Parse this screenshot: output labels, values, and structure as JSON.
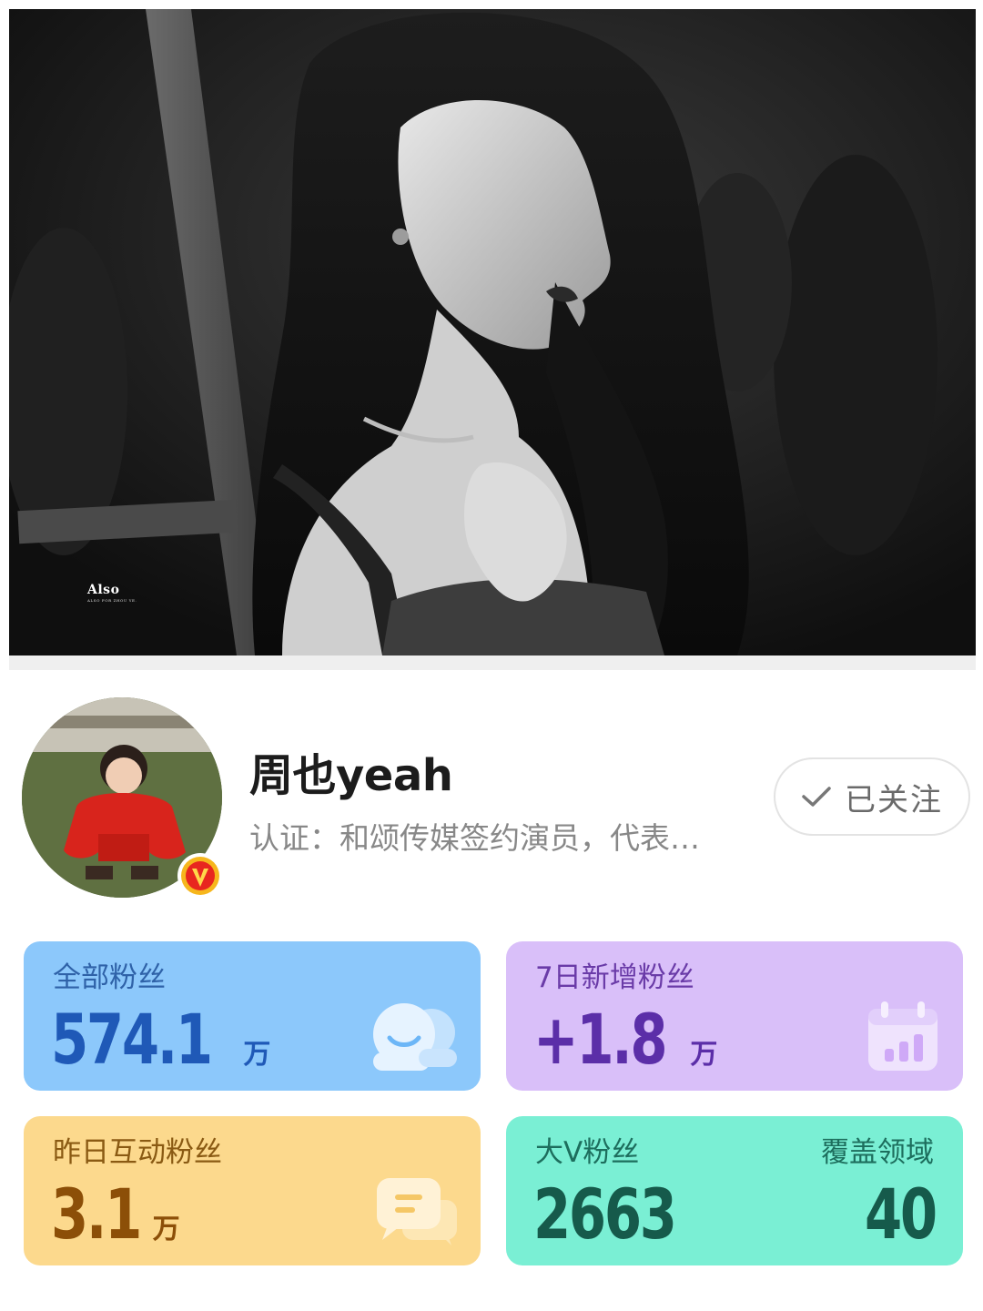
{
  "banner": {
    "watermark_title": "Also",
    "watermark_subtitle": "ALSO FOR ZHOU YE."
  },
  "profile": {
    "name": "周也yeah",
    "certification": "认证：和颂传媒签约演员，代表…",
    "avatar_icon": "avatar-photo",
    "verified_badge_icon": "verified-v-badge-icon"
  },
  "follow_button": {
    "label": "已关注",
    "icon": "check-icon"
  },
  "stats": {
    "total_fans": {
      "label": "全部粉丝",
      "value": "574.1",
      "unit": "万",
      "icon": "users-icon",
      "color": "#8cc8fb"
    },
    "new_fans_7d": {
      "label": "7日新增粉丝",
      "value": "+1.8",
      "unit": "万",
      "icon": "calendar-chart-icon",
      "color": "#d9bff9"
    },
    "interactive_fans_yesterday": {
      "label": "昨日互动粉丝",
      "value": "3.1",
      "unit": "万",
      "icon": "chat-icon",
      "color": "#fcd98d"
    },
    "big_v_fans": {
      "label": "大V粉丝",
      "value": "2663",
      "coverage_label": "覆盖领域",
      "coverage_value": "40",
      "color": "#7aefd4"
    }
  }
}
